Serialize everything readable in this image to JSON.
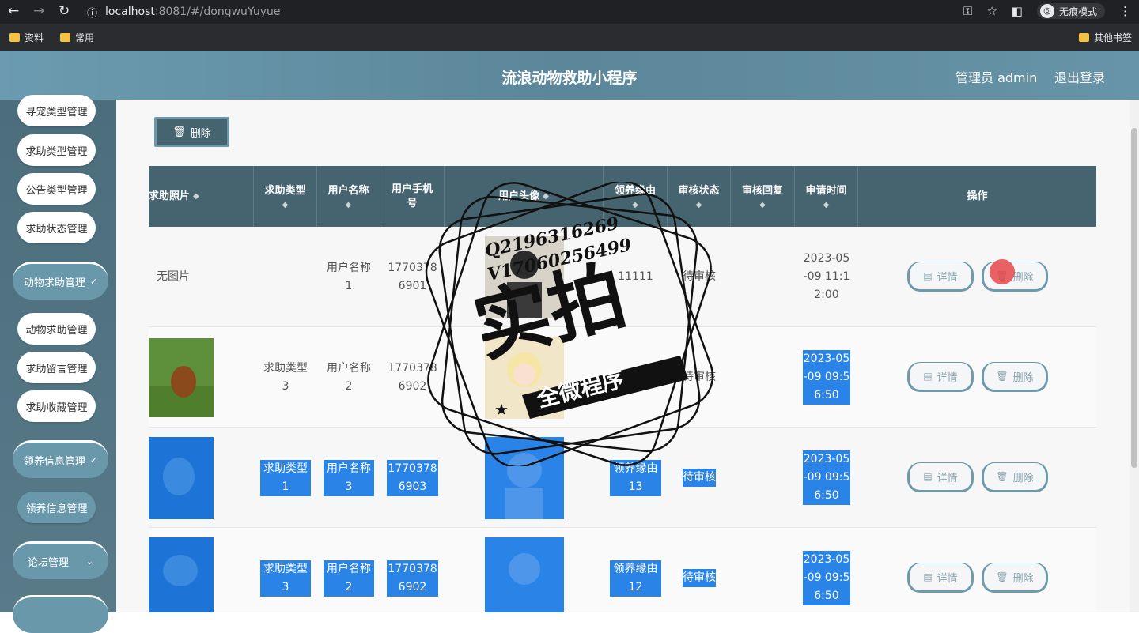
{
  "browser": {
    "url_host": "localhost",
    "url_path": ":8081/#/dongwuYuyue",
    "incognito_label": "无痕模式",
    "bookmarks": [
      "资料",
      "常用"
    ],
    "other_bookmarks": "其他书签"
  },
  "header": {
    "title": "流浪动物救助小程序",
    "admin": "管理员 admin",
    "logout": "退出登录"
  },
  "sidebar": {
    "items": [
      {
        "label": "寻宠类型管理"
      },
      {
        "label": "求助类型管理"
      },
      {
        "label": "公告类型管理"
      },
      {
        "label": "求助状态管理"
      },
      {
        "label": "动物求助管理"
      },
      {
        "label": "动物求助管理"
      },
      {
        "label": "求助留言管理"
      },
      {
        "label": "求助收藏管理"
      },
      {
        "label": "领养信息管理"
      },
      {
        "label": "领养信息管理"
      },
      {
        "label": "论坛管理"
      }
    ]
  },
  "toolbar": {
    "delete_label": "删除"
  },
  "table": {
    "headers": [
      "求助照片",
      "求助类型",
      "用户名称",
      "用户手机号",
      "用户头像",
      "领养缘由",
      "审核状态",
      "审核回复",
      "申请时间",
      "操作"
    ],
    "detail_label": "详情",
    "delete_label": "删除",
    "rows": [
      {
        "photo": "无图片",
        "type": "",
        "user": "用户名称1",
        "phone": "17703786901",
        "reason": "11111",
        "status": "待审核",
        "reply": "",
        "time": "2023-05-09 11:12:00"
      },
      {
        "photo": "",
        "type": "求助类型3",
        "user": "用户名称2",
        "phone": "17703786902",
        "reason": "领养缘由",
        "status": "待审核",
        "reply": "",
        "time": "2023-05-09 09:56:50"
      },
      {
        "photo": "",
        "type": "求助类型1",
        "user": "用户名称3",
        "phone": "17703786903",
        "reason": "领养缘由13",
        "status": "待审核",
        "reply": "",
        "time": "2023-05-09 09:56:50"
      },
      {
        "photo": "",
        "type": "求助类型3",
        "user": "用户名称2",
        "phone": "17703786902",
        "reason": "领养缘由12",
        "status": "待审核",
        "reply": "",
        "time": "2023-05-09 09:56:50"
      }
    ]
  },
  "watermark": {
    "line1": "Q2196316269",
    "line2": "V17060256499",
    "big": "实拍",
    "banner": "全微程序"
  }
}
